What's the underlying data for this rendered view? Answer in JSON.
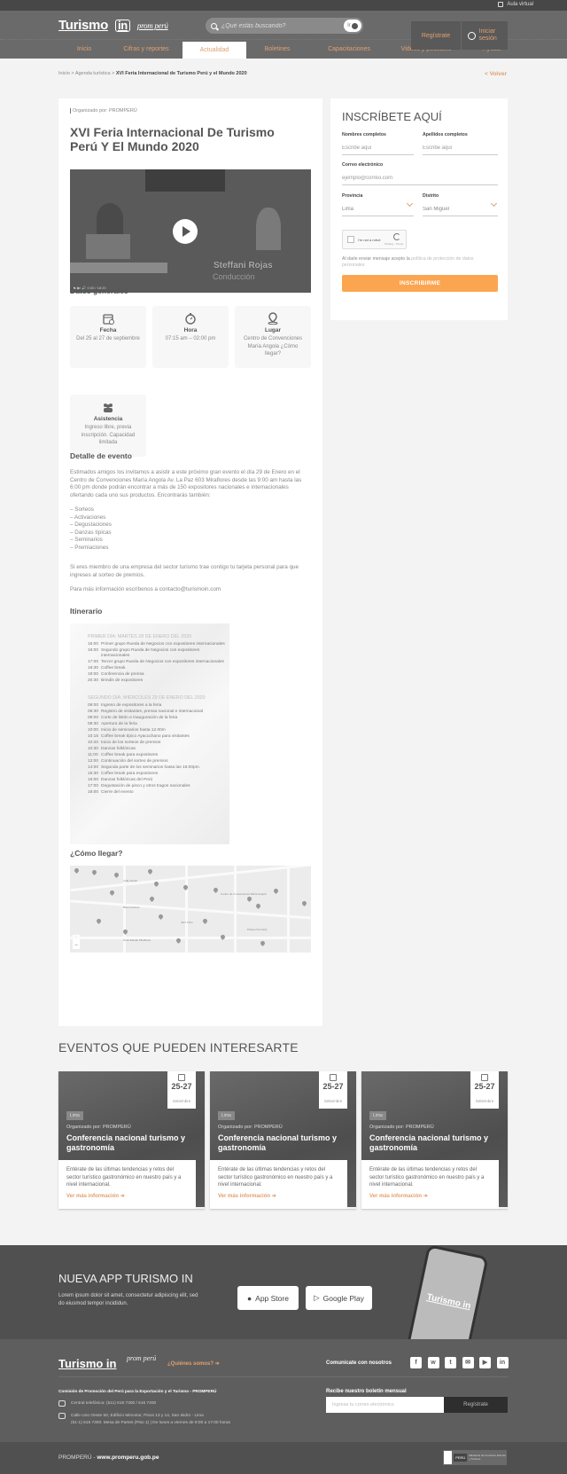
{
  "topbar": {
    "aula_virtual": "Aula virtual"
  },
  "header": {
    "logo_text": "Turismo",
    "logo_in": "in",
    "partner_logo": "prom perú",
    "search_placeholder": "¿Qué estás buscando?",
    "search_button": "Ir",
    "register": "Regístrate",
    "login": "Iniciar sesión"
  },
  "nav": {
    "items": [
      {
        "label": "Inicio"
      },
      {
        "label": "Cifras y reportes"
      },
      {
        "label": "Actualidad",
        "active": true
      },
      {
        "label": "Boletines"
      },
      {
        "label": "Capacitaciones"
      },
      {
        "label": "Videos y podcasts"
      },
      {
        "label": "Ayuda"
      }
    ]
  },
  "breadcrumb": {
    "items": [
      "Inicio",
      "Agenda turística"
    ],
    "separator": " > ",
    "current": "XVI Feria Internacional de Turismo Perú y el Mundo 2020",
    "back": "< Volver"
  },
  "event": {
    "organizer_label": "Organizado por:",
    "organizer": "PROMPERÚ",
    "title": "XVI Feria Internacional De Turismo Perú Y El Mundo 2020",
    "video": {
      "person": "Steffani Rojas",
      "role": "Conducción",
      "time": "0:00 / 18:20"
    },
    "general_heading": "Datos generales",
    "general": [
      {
        "icon": "calendar-icon",
        "label": "Fecha",
        "value": "Del 25 al 27 de septiembre"
      },
      {
        "icon": "stopwatch-icon",
        "label": "Hora",
        "value": "07:15 am – 02:00 pm"
      },
      {
        "icon": "location-pin-icon",
        "label": "Lugar",
        "value": "Centro de Convenciones María Angola ¿Cómo llegar?"
      },
      {
        "icon": "people-icon",
        "label": "Asistencia",
        "value": "Ingreso libre, previa inscripción. Capacidad limitada"
      }
    ],
    "detail_heading": "Detalle de evento",
    "detail_intro": "Estimados amigos los invitamos a asistir a este próximo gran evento el día 29 de Enero en el Centro de Convenciones María Angola Av. La Paz 603 Miraflores desde las 9:00 am hasta las 6:00 pm donde podrán encontrar a más de 150 expositores nacionales e internacionales ofertando cada uno sus productos. Encontrarás también:",
    "detail_list": [
      "– Sorteos",
      "– Activaciones",
      "– Degustaciones",
      "– Danzas típicas",
      "– Seminarios",
      "– Premiaciones"
    ],
    "detail_member": "Si eres miembro de una empresa del sector turismo trae contigo tu tarjeta personal para que ingreses al sorteo de premios.",
    "detail_contact": "Para más información escríbenos a contacto@turismoin.com",
    "itinerary_heading": "Itinerario",
    "itinerary": [
      {
        "day": "PRIMER DÍA: MARTES 28 DE ENERO DEL 2020",
        "rows": [
          [
            "15:00",
            "Primer grupo Rueda de Negocios con expositores internacionales"
          ],
          [
            "16:00",
            "Segundo grupo Rueda de Negocios con expositores internacionales"
          ],
          [
            "17:00",
            "Tercer grupo Rueda de Negocios con expositores internacionales"
          ],
          [
            "18:30",
            "Coffee break"
          ],
          [
            "19:00",
            "Conferencia de prensa"
          ],
          [
            "20:30",
            "Brindis de expositores"
          ]
        ]
      },
      {
        "day": "SEGUNDO DÍA: MIÉRCOLES 29 DE ENERO DEL 2020",
        "rows": [
          [
            "08:00",
            "Ingreso de expositores a la feria"
          ],
          [
            "08:30",
            "Registro de visitantes, prensa nacional e internacional"
          ],
          [
            "09:00",
            "Corte de listón e inauguración de la feria"
          ],
          [
            "09:30",
            "Apertura de la feria"
          ],
          [
            "10:00",
            "Inicio de seminarios hasta 12.00m"
          ],
          [
            "10:15",
            "Coffee break típico Ayacuchano para visitantes"
          ],
          [
            "10:20",
            "Inicio de los sorteos de premios"
          ],
          [
            "10:30",
            "Danzas folklóricas"
          ],
          [
            "11:00",
            "Coffee break para expositores"
          ],
          [
            "12:00",
            "Continuación del sorteo de premios"
          ],
          [
            "14:00",
            "Segunda parte de los seminarios hasta las 16:00pm."
          ],
          [
            "15:30",
            "Coffee break para expositores"
          ],
          [
            "16:00",
            "Danzas folklóricas del Perú"
          ],
          [
            "17:00",
            "Degustación de pisco y otros tragos nacionales"
          ],
          [
            "18:00",
            "Cierre del evento"
          ]
        ]
      }
    ],
    "map_heading": "¿Cómo llegar?",
    "map_labels": [
      "Calle Schell",
      "Centro de Convenciones María Angola",
      "Hotel Estelar Miraflores",
      "Jazz Zone",
      "Banco Azteca",
      "Parque Kennedy"
    ]
  },
  "form": {
    "title": "INSCRÍBETE AQUÍ",
    "first_name": {
      "label": "Nombres completos",
      "placeholder": "Escribe aquí"
    },
    "last_name": {
      "label": "Apellidos completos",
      "placeholder": "Escribe aquí"
    },
    "email": {
      "label": "Correo electrónico",
      "placeholder": "ejemplo@correo.com"
    },
    "province": {
      "label": "Provincia",
      "value": "Lima"
    },
    "district": {
      "label": "Distrito",
      "value": "San Miguel"
    },
    "captcha": {
      "text": "I'm not a robot",
      "brand": "reCAPTCHA",
      "links": "Privacy - Terms"
    },
    "policy_prefix": "Al darle enviar mensaje acepto la",
    "policy_link": "política de protección de datos personales.",
    "submit": "INSCRIBIRME"
  },
  "related": {
    "heading": "EVENTOS QUE PUEDEN INTERESARTE",
    "cards": [
      {
        "date": "25-27",
        "month": "Setiembre",
        "tag": "Lima",
        "organizer": "Organizado por:  PROMPERÚ",
        "title": "Conferencia nacional turismo y gastronomía",
        "desc": "Entérate de  las últimas tendencias y retos del sector turístico gastronómico  en nuestro país y a nivel internacional.",
        "link": "Ver más información  ➔"
      },
      {
        "date": "25-27",
        "month": "Setiembre",
        "tag": "Lima",
        "organizer": "Organizado por:  PROMPERÚ",
        "title": "Conferencia nacional turismo y gastronomía",
        "desc": "Entérate de  las últimas tendencias y retos del sector turístico gastronómico  en nuestro país y a nivel internacional.",
        "link": "Ver más información  ➔"
      },
      {
        "date": "25-27",
        "month": "Setiembre",
        "tag": "Lima",
        "organizer": "Organizado por:  PROMPERÚ",
        "title": "Conferencia nacional turismo y gastronomía",
        "desc": "Entérate de  las últimas tendencias y retos del sector turístico gastronómico  en nuestro país y a nivel internacional.",
        "link": "Ver más información  ➔"
      }
    ]
  },
  "app": {
    "title": "NUEVA APP TURISMO IN",
    "text": "Lorem ipsum dolor sit amet, consectetur adipiscing elit, sed do eiusmod tempor incididun.",
    "app_store": "App Store",
    "google_play": "Google Play",
    "phone_logo": "Turismo in"
  },
  "footer": {
    "who": "¿Quiénes somos?  ➔",
    "contact": "Comunícate con nosotros",
    "social": [
      "f",
      "w",
      "t",
      "✉",
      "▶",
      "in"
    ],
    "org": "Comisión de Promoción del Perú para la Exportación y el Turismo - PROMPERÚ",
    "phone": "Central telefónica: (511) 616 7300 / 616 7400",
    "address": "Calle Uno Oeste 50, Edificio Mincetur, Pisos 13 y 14, San Isidro - Lima",
    "hours": "(51-1) 616 7300. Mesa de Partes (Piso 1) | De lunes a viernes de 9:00 a 17:00 horas",
    "newsletter_title": "Recibe nuestro boletín mensual",
    "newsletter_placeholder": "Ingresa tu correo electrónico",
    "newsletter_button": "Regístrate",
    "bottom_prefix": "PROMPERÚ - ",
    "bottom_url": "www.promperu.gob.pe",
    "gov_peru": "PERÚ",
    "gov_ministry": "Ministerio de Comercio Exterior y Turismo"
  },
  "colors": {
    "accent": "#fca550",
    "link": "#e0a070",
    "header": "#6a6a6a",
    "footer": "#5e5e5e"
  }
}
